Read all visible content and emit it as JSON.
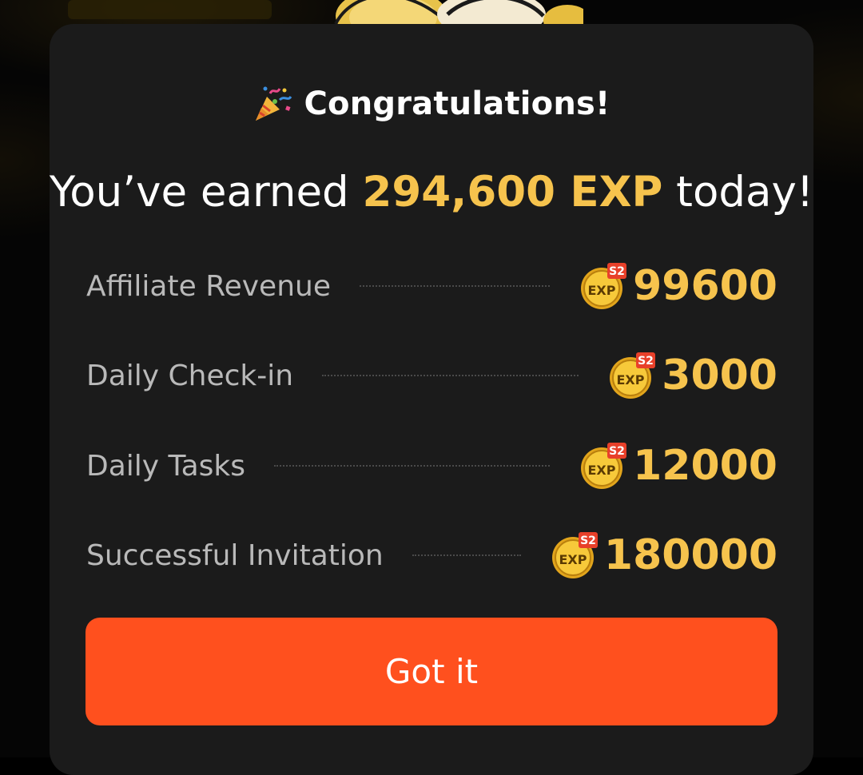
{
  "modal": {
    "title": "Congratulations!",
    "earned_prefix": "You’ve earned ",
    "earned_amount": "294,600 EXP",
    "earned_suffix": " today!",
    "rows": [
      {
        "label": "Affiliate Revenue",
        "value": "99600"
      },
      {
        "label": "Daily Check-in",
        "value": "3000"
      },
      {
        "label": "Daily Tasks",
        "value": "12000"
      },
      {
        "label": "Successful Invitation",
        "value": "180000"
      }
    ],
    "badge": {
      "text": "EXP",
      "season": "S2"
    },
    "button_label": "Got it"
  },
  "icons": {
    "title_icon": "party-popper-icon",
    "badge_icon": "exp-coin-icon"
  },
  "colors": {
    "accent_gold": "#f6c34d",
    "button_orange": "#ff501e",
    "modal_bg": "#1b1b1b",
    "badge_red": "#e8402a"
  }
}
